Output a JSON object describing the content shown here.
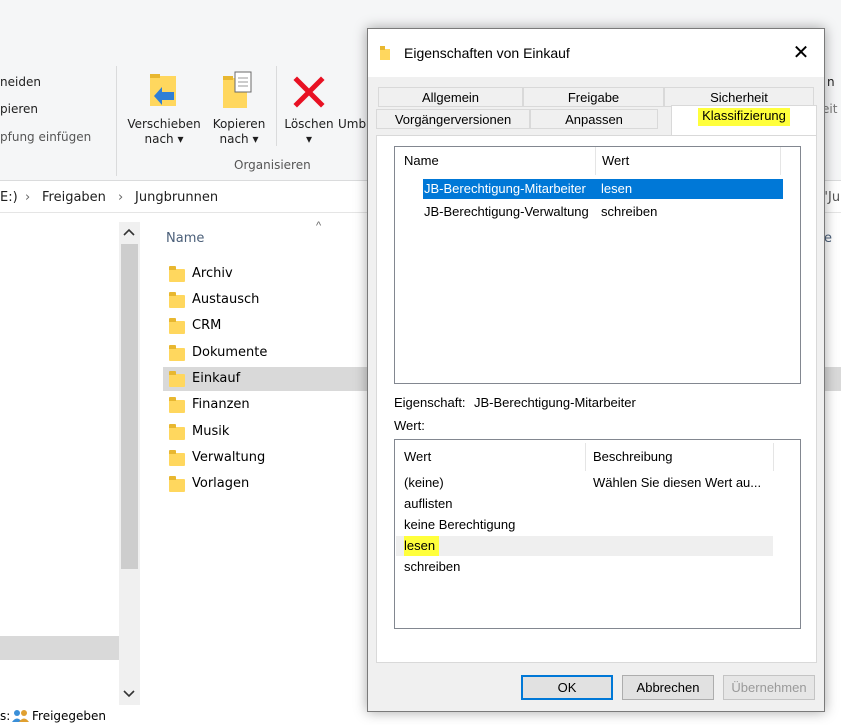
{
  "explorer": {
    "ribbon": {
      "cut_partial": "neiden",
      "copy_path_partial": "pieren",
      "paste_shortcut_partial": "pfung einfügen",
      "move_to": "Verschieben",
      "move_to_sub": "nach ▾",
      "copy_to": "Kopieren",
      "copy_to_sub": "nach ▾",
      "delete": "Löschen",
      "delete_sub": "▾",
      "rename_partial": "Umb",
      "group_organize": "Organisieren",
      "right_partial_1": "n",
      "right_partial_2": "eit"
    },
    "address": {
      "drive_partial": "E:)",
      "sep1": "›",
      "crumb1": "Freigaben",
      "sep2": "›",
      "crumb2": "Jungbrunnen",
      "search_partial": "\"Ju"
    },
    "column_name": "Name",
    "column_right_partial": "e",
    "sort_arrow": "^",
    "folders": [
      "Archiv",
      "Austausch",
      "CRM",
      "Dokumente",
      "Einkauf",
      "Finanzen",
      "Musik",
      "Verwaltung",
      "Vorlagen"
    ],
    "selected_folder": "Einkauf",
    "status_partial": "s:",
    "status_shared": "Freigegeben"
  },
  "dialog": {
    "title": "Eigenschaften von Einkauf",
    "close_glyph": "✕",
    "tabs_row1": [
      "Allgemein",
      "Freigabe",
      "Sicherheit"
    ],
    "tabs_row2": [
      "Vorgängerversionen",
      "Anpassen",
      "Klassifizierung"
    ],
    "active_tab": "Klassifizierung",
    "props_list": {
      "col_name": "Name",
      "col_value": "Wert",
      "rows": [
        {
          "name": "JB-Berechtigung-Mitarbeiter",
          "value": "lesen"
        },
        {
          "name": "JB-Berechtigung-Verwaltung",
          "value": "schreiben"
        }
      ]
    },
    "property_label": "Eigenschaft:",
    "property_value": "JB-Berechtigung-Mitarbeiter",
    "value_label": "Wert:",
    "values_list": {
      "col_value": "Wert",
      "col_desc": "Beschreibung",
      "rows": [
        {
          "value": "(keine)",
          "desc": "Wählen Sie diesen Wert au..."
        },
        {
          "value": "auflisten",
          "desc": ""
        },
        {
          "value": "keine Berechtigung",
          "desc": ""
        },
        {
          "value": "lesen",
          "desc": ""
        },
        {
          "value": "schreiben",
          "desc": ""
        }
      ]
    },
    "buttons": {
      "ok": "OK",
      "cancel": "Abbrechen",
      "apply": "Übernehmen"
    }
  },
  "colors": {
    "selection": "#0078d7",
    "highlight": "#ffff3c",
    "folder": "#ffd75e",
    "delete_red": "#e81123"
  }
}
